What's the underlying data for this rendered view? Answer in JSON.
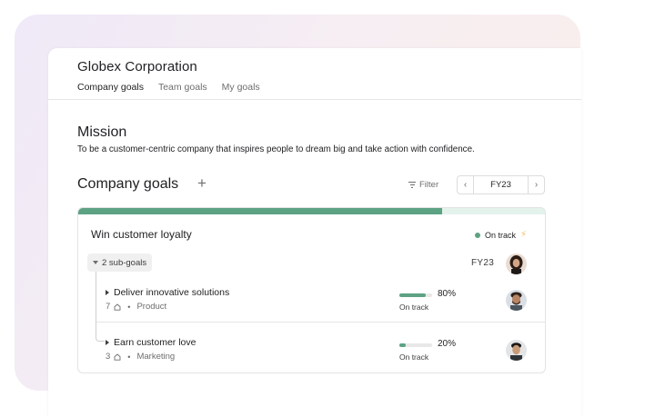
{
  "header": {
    "company": "Globex Corporation",
    "tabs": [
      {
        "label": "Company goals",
        "active": true
      },
      {
        "label": "Team goals",
        "active": false
      },
      {
        "label": "My goals",
        "active": false
      }
    ]
  },
  "mission": {
    "title": "Mission",
    "text": "To be a customer-centric company that inspires people to dream big and take action with confidence."
  },
  "goals_section": {
    "title": "Company goals",
    "add_icon": "plus-icon",
    "filter_label": "Filter",
    "period": "FY23"
  },
  "goal": {
    "title": "Win customer loyalty",
    "status": "On track",
    "progress": 0.78,
    "period": "FY23",
    "subgoals_label": "2 sub-goals",
    "subgoals": [
      {
        "title": "Deliver innovative solutions",
        "count": "7",
        "team": "Product",
        "progress": 80,
        "progress_label": "80%",
        "status": "On track"
      },
      {
        "title": "Earn customer love",
        "count": "3",
        "team": "Marketing",
        "progress": 20,
        "progress_label": "20%",
        "status": "On track"
      }
    ]
  },
  "colors": {
    "accent_green": "#5da283",
    "bolt_yellow": "#f1bd6c",
    "text": "#1e1f21",
    "muted": "#6d6e6f"
  }
}
